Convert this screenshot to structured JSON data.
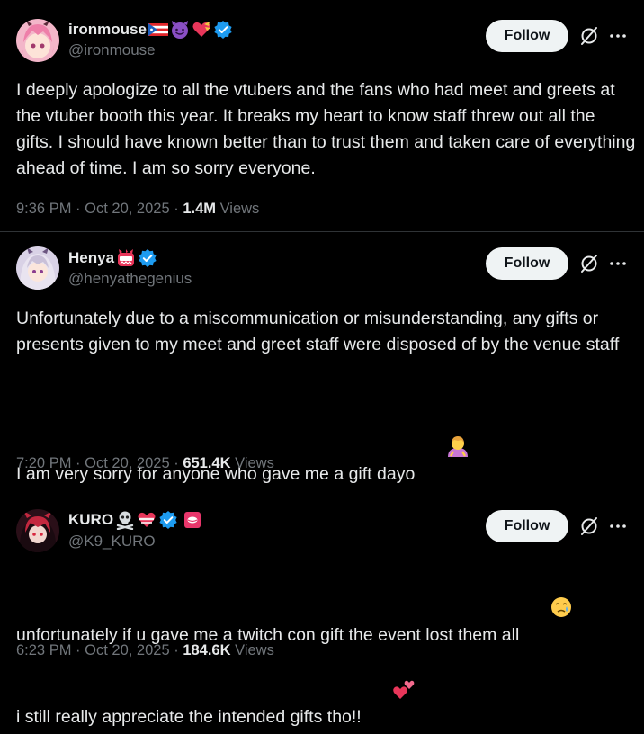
{
  "posts": [
    {
      "display_name": "ironmouse",
      "name_emojis": [
        "puerto-rico-flag",
        "smiling-devil-face",
        "heart-with-ribbon"
      ],
      "verified": true,
      "handle": "@ironmouse",
      "follow_label": "Follow",
      "text": "I deeply apologize to all the vtubers and the fans who had meet and greets at the vtuber booth this year. It breaks my heart to know staff threw out all the gifts. I should have known better than to trust them and taken care of everything ahead of time. I am so sorry everyone.",
      "time": "9:36 PM",
      "date": "Oct 20, 2025",
      "views_count": "1.4M",
      "views_label": "Views"
    },
    {
      "display_name": "Henya",
      "name_emojis": [
        "oni-face"
      ],
      "verified": true,
      "handle": "@henyathegenius",
      "follow_label": "Follow",
      "text_line1": "Unfortunately due to a miscommunication or misunderstanding, any gifts or presents given to my meet and greet staff were disposed of by the venue staff",
      "text_line2": "I am very sorry for anyone who gave me a gift dayo",
      "text_emoji": "person-bowing",
      "time": "7:20 PM",
      "date": "Oct 20, 2025",
      "views_count": "651.4K",
      "views_label": "Views"
    },
    {
      "display_name": "KURO",
      "name_emojis": [
        "skull-and-crossbones",
        "heart-with-ribbon"
      ],
      "verified": true,
      "affiliate_badge": "pink-badge",
      "handle": "@K9_KURO",
      "follow_label": "Follow",
      "text_line1": "unfortunately if u gave me a twitch con gift the event lost them all",
      "text_line1_emoji": "crying-face",
      "text_line2": "i still really appreciate the intended gifts tho!!",
      "text_line2_emoji": "two-hearts",
      "time": "6:23 PM",
      "date": "Oct 20, 2025",
      "views_count": "184.6K",
      "views_label": "Views"
    }
  ],
  "colors": {
    "background": "#000000",
    "text": "#e7e9ea",
    "muted": "#71767b",
    "verified": "#1d9bf0",
    "follow_bg": "#eff3f4",
    "separator": "#2f3336"
  },
  "meta_separator": "·"
}
